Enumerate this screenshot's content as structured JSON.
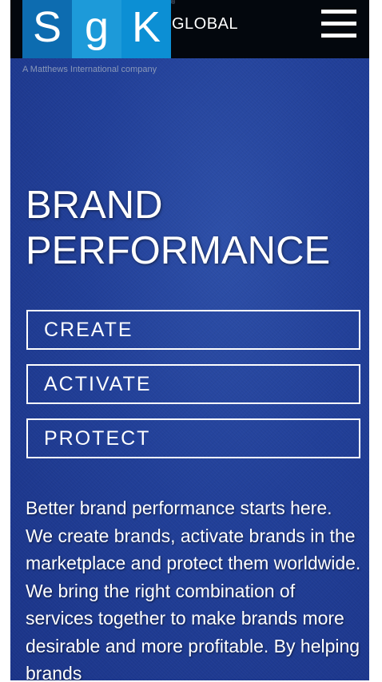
{
  "header": {
    "logo": {
      "letters": [
        "S",
        "g",
        "K"
      ],
      "registered": "®",
      "wordmark": "GLOBAL"
    },
    "tagline": "A Matthews International company",
    "menu_icon": "hamburger-menu-icon"
  },
  "hero": {
    "title_line_1": "BRAND",
    "title_line_2": "PERFORMANCE"
  },
  "services": [
    {
      "label": "CREATE"
    },
    {
      "label": "ACTIVATE"
    },
    {
      "label": "PROTECT"
    }
  ],
  "intro": {
    "text": "Better brand performance starts here. We create brands, activate brands in the marketplace and protect them worldwide. We bring the right combination of services together to make brands more desirable and more profitable. By helping brands"
  },
  "colors": {
    "topbar": "#03070d",
    "background": "#213f98",
    "logo_s": "#0d6cb0",
    "logo_g": "#1d9ad9",
    "logo_k": "#0c8fd4",
    "text": "#ffffff"
  }
}
